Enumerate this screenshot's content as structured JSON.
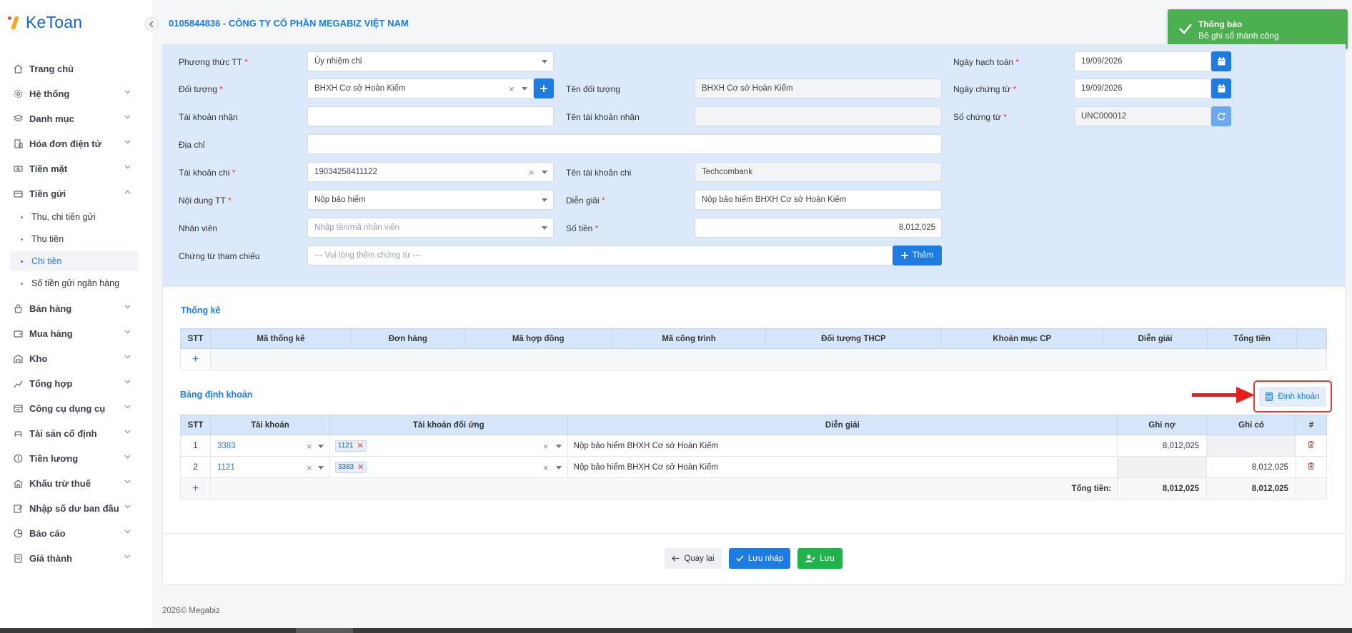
{
  "app": {
    "logo_text": "KeToan",
    "company": "0105844836 - CÔNG TY CỔ PHẦN MEGABIZ VIỆT NAM",
    "footer": "2026© Megabiz"
  },
  "sidebar": {
    "items": [
      {
        "label": "Trang chủ",
        "icon": "home-icon"
      },
      {
        "label": "Hệ thống",
        "icon": "gear-icon"
      },
      {
        "label": "Danh mục",
        "icon": "layers-icon"
      },
      {
        "label": "Hóa đơn điện tử",
        "icon": "invoice-icon"
      },
      {
        "label": "Tiền mặt",
        "icon": "cash-icon"
      },
      {
        "label": "Tiền gửi",
        "icon": "bank-icon"
      },
      {
        "label": "Bán hàng",
        "icon": "sales-icon"
      },
      {
        "label": "Mua hàng",
        "icon": "purchase-icon"
      },
      {
        "label": "Kho",
        "icon": "warehouse-icon"
      },
      {
        "label": "Tổng hợp",
        "icon": "chart-icon"
      },
      {
        "label": "Công cụ dụng cụ",
        "icon": "tools-icon"
      },
      {
        "label": "Tài sản cố định",
        "icon": "car-icon"
      },
      {
        "label": "Tiền lương",
        "icon": "salary-icon"
      },
      {
        "label": "Khấu trừ thuế",
        "icon": "tax-icon"
      },
      {
        "label": "Nhập số dư ban đầu",
        "icon": "edit-icon"
      },
      {
        "label": "Báo cáo",
        "icon": "report-icon"
      },
      {
        "label": "Giá thành",
        "icon": "price-icon"
      }
    ],
    "sub_items": [
      "Thu, chi tiền gửi",
      "Thu tiền",
      "Chi tiền",
      "Số tiền gửi ngân hàng"
    ]
  },
  "toast": {
    "title": "Thông báo",
    "message": "Bỏ ghi sổ thành công"
  },
  "form": {
    "phuong_thuc": {
      "label": "Phương thức TT",
      "value": "Ủy nhiệm chi"
    },
    "doi_tuong": {
      "label": "Đối tượng",
      "value": "BHXH Cơ sở Hoàn Kiếm"
    },
    "ten_doi_tuong": {
      "label": "Tên đối tượng",
      "value": "BHXH Cơ sở Hoàn Kiếm"
    },
    "tk_nhan": {
      "label": "Tài khoản nhận",
      "value": ""
    },
    "ten_tk_nhan": {
      "label": "Tên tài khoản nhận",
      "value": ""
    },
    "dia_chi": {
      "label": "Địa chỉ",
      "value": ""
    },
    "tk_chi": {
      "label": "Tài khoản chi",
      "value": "19034258411122"
    },
    "ten_tk_chi": {
      "label": "Tên tài khoản chi",
      "value": "Techcombank"
    },
    "noi_dung": {
      "label": "Nội dung TT",
      "value": "Nộp bảo hiểm"
    },
    "dien_giai": {
      "label": "Diễn giải",
      "value": "Nộp bảo hiểm BHXH Cơ sở Hoàn Kiếm"
    },
    "nhan_vien": {
      "label": "Nhân viên",
      "placeholder": "Nhập tên/mã nhân viên"
    },
    "so_tien": {
      "label": "Số tiền",
      "value": "8,012,025"
    },
    "chung_tu": {
      "label": "Chứng từ tham chiếu",
      "placeholder": "--- Vui lòng thêm chứng từ ---",
      "button": "Thêm"
    },
    "ngay_hach_toan": {
      "label": "Ngày hạch toán",
      "value": "19/09/2026"
    },
    "ngay_chung_tu": {
      "label": "Ngày chứng từ",
      "value": "19/09/2026"
    },
    "so_chung_tu": {
      "label": "Số chứng từ",
      "value": "UNC000012"
    }
  },
  "thong_ke": {
    "title": "Thống kê",
    "columns": [
      "STT",
      "Mã thống kê",
      "Đơn hàng",
      "Mã hợp đồng",
      "Mã công trình",
      "Đối tượng THCP",
      "Khoản mục CP",
      "Diễn giải",
      "Tổng tiền",
      ""
    ]
  },
  "dinh_khoan": {
    "title": "Bảng định khoản",
    "button": "Định khoản",
    "columns": [
      "STT",
      "Tài khoản",
      "Tài khoản đối ứng",
      "Diễn giải",
      "Ghi nợ",
      "Ghi có",
      "#"
    ],
    "rows": [
      {
        "stt": "1",
        "tk": "3383",
        "doi_ung": "1121",
        "dien_giai": "Nộp bảo hiểm BHXH Cơ sở Hoàn Kiếm",
        "no": "8,012,025",
        "co": ""
      },
      {
        "stt": "2",
        "tk": "1121",
        "doi_ung": "3383",
        "dien_giai": "Nộp bảo hiểm BHXH Cơ sở Hoàn Kiếm",
        "no": "",
        "co": "8,012,025"
      }
    ],
    "total_label": "Tổng tiền:",
    "total_no": "8,012,025",
    "total_co": "8,012,025"
  },
  "actions": {
    "back": "Quay lại",
    "draft": "Lưu nháp",
    "save": "Lưu"
  },
  "colors": {
    "accent": "#1e7be0",
    "toast": "#4caf50",
    "danger": "#e53935",
    "form_bg": "#dce9fb"
  }
}
